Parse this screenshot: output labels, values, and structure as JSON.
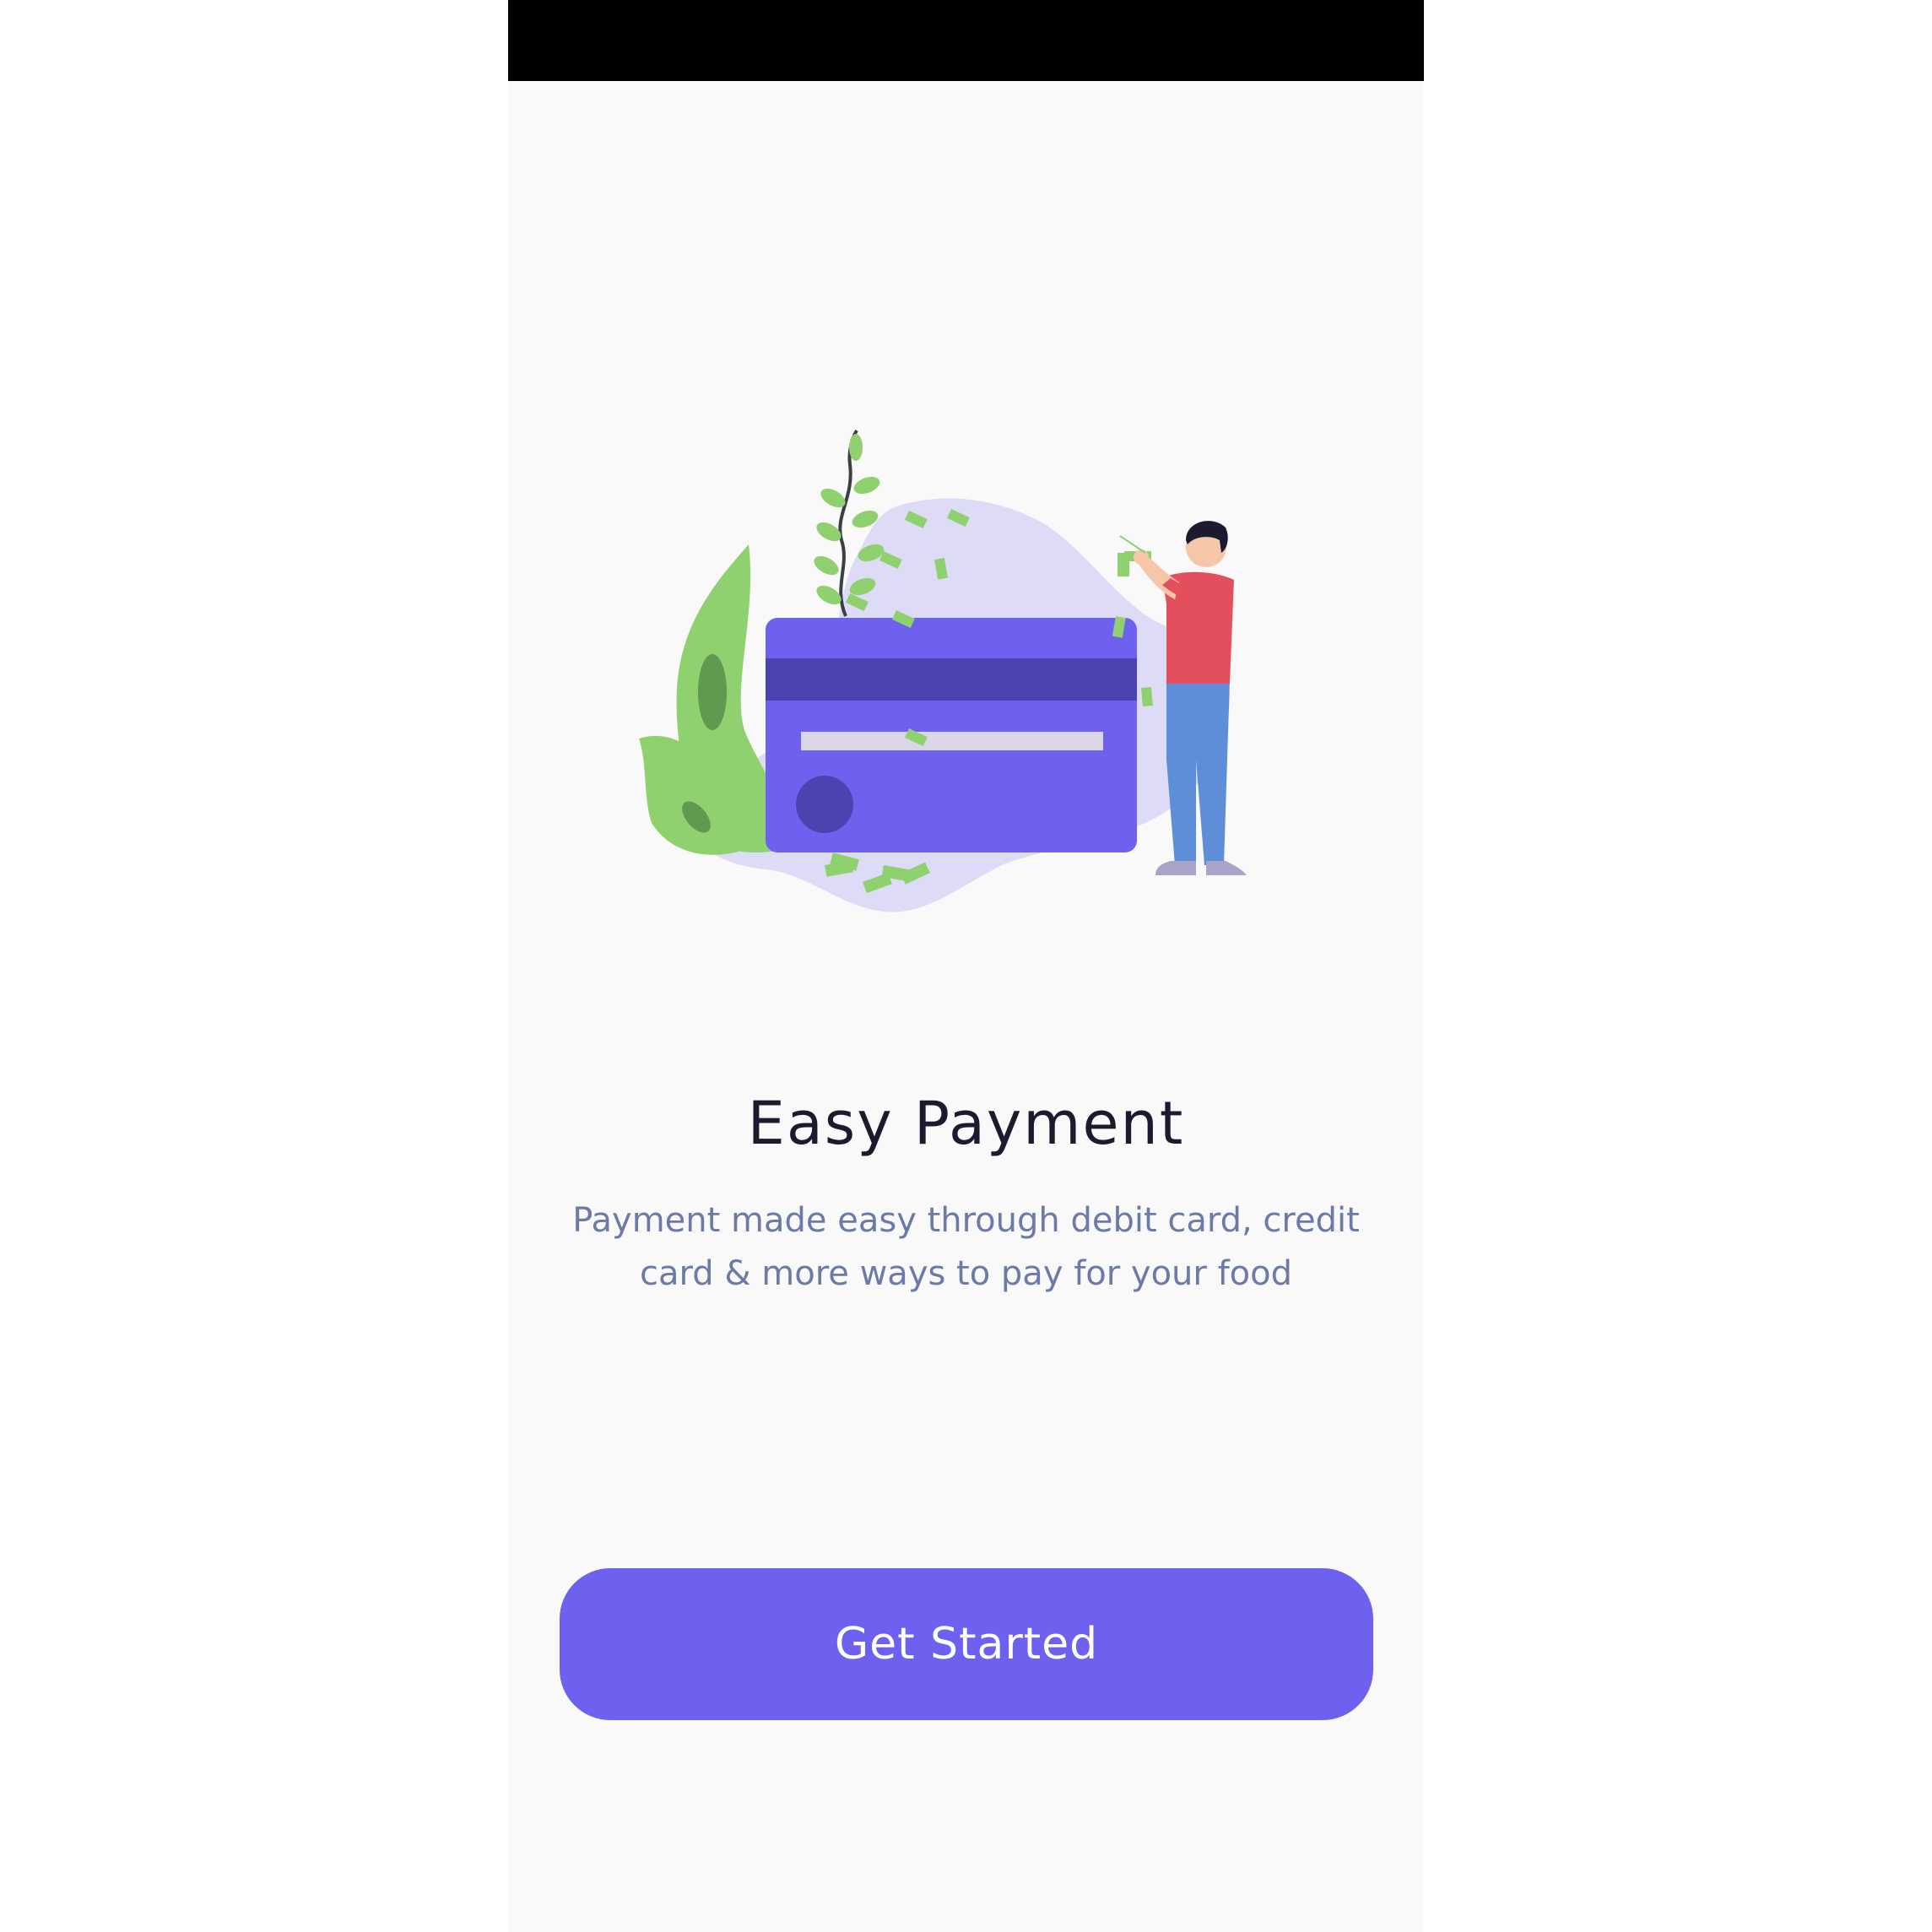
{
  "onboarding": {
    "title": "Easy Payment",
    "description": "Payment made easy through debit card, credit\ncard  & more ways to pay for your food",
    "cta_label": "Get Started"
  },
  "colors": {
    "accent": "#6e61f0",
    "accent_dark": "#4b44b0",
    "title": "#1c1a2e",
    "description": "#6b7aa6",
    "background": "#f9f9f9",
    "status_bar": "#000000"
  },
  "illustration": {
    "icon": "credit-card-payment-illustration"
  }
}
